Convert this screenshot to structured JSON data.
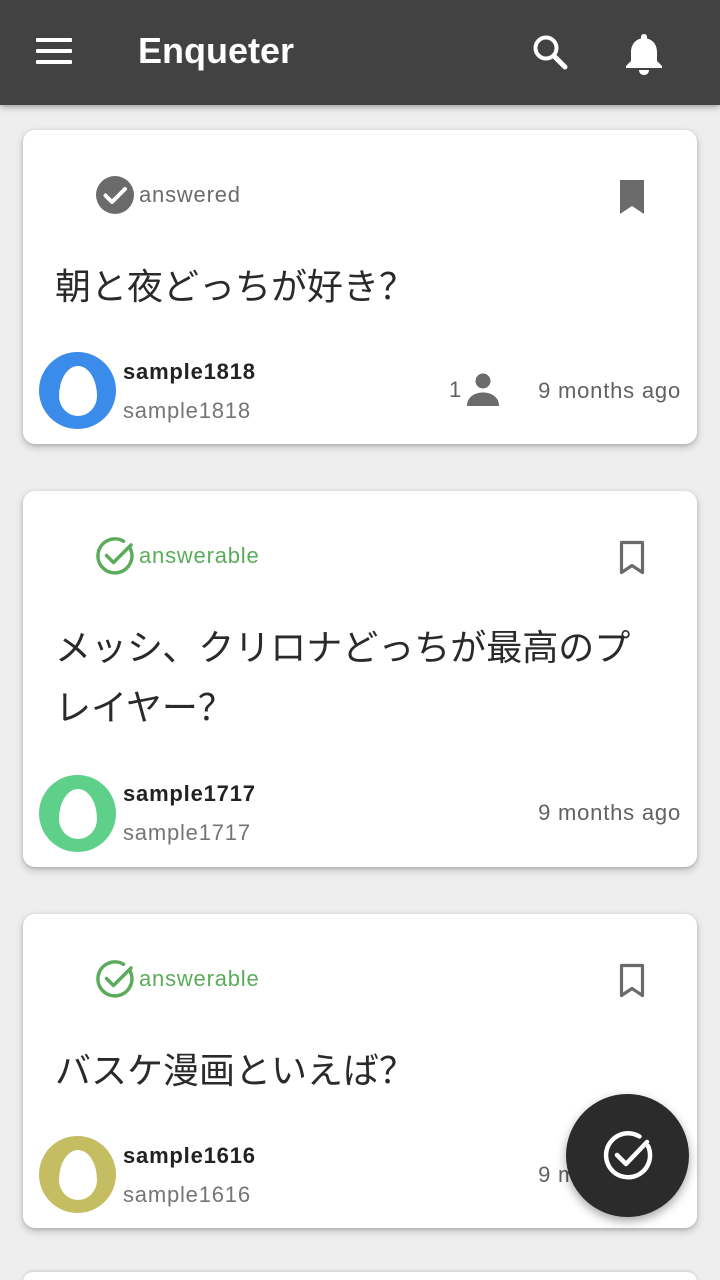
{
  "app": {
    "title": "Enqueter"
  },
  "icons": {
    "menu": "menu-icon",
    "search": "search-icon",
    "notifications": "bell-icon",
    "answered": "check-circle-filled-icon",
    "answerable": "check-circle-outline-icon",
    "bookmark_filled": "bookmark-filled-icon",
    "bookmark_outline": "bookmark-outline-icon",
    "person": "person-icon",
    "fab": "check-circle-icon"
  },
  "colors": {
    "appbar": "#424242",
    "answered": "#6b6b6b",
    "answerable": "#5aac5a",
    "background": "#eeeeee"
  },
  "posts": [
    {
      "status": "answered",
      "status_color": "#6b6b6b",
      "bookmarked": true,
      "question": "朝と夜どっちが好き？",
      "user_name": "sample1818",
      "user_id": "sample1818",
      "avatar_color": "#3b8beb",
      "answer_count": "1",
      "time": "9 months ago"
    },
    {
      "status": "answerable",
      "status_color": "#5aac5a",
      "bookmarked": false,
      "question": "メッシ、クリロナどっちが最高のプレイヤー？",
      "user_name": "sample1717",
      "user_id": "sample1717",
      "avatar_color": "#5fd08a",
      "time": "9 months ago"
    },
    {
      "status": "answerable",
      "status_color": "#5aac5a",
      "bookmarked": false,
      "question": "バスケ漫画といえば？",
      "user_name": "sample1616",
      "user_id": "sample1616",
      "avatar_color": "#c4bd62",
      "time": "9 months ago"
    }
  ]
}
